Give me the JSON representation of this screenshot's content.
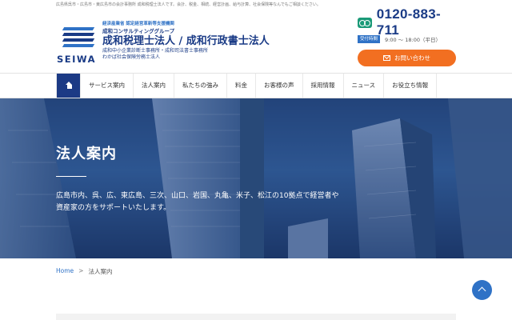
{
  "top_note": "広島県呉市・広島市・東広島市の会計事務所 成和税理士法人です。会計、税金、相続、経営計画、給与計算、社会保険等なんでもご相談ください。",
  "logo": {
    "tagline": "経済産業省 認定経営革新等支援機関",
    "wordmark": "SEIWA",
    "group": "成和コンサルティンググループ",
    "name": "成和税理士法人 / 成和行政書士法人",
    "sub1": "成和中小企業診断士事務所・成和司法書士事務所",
    "sub2": "わかば社会保険労務士法人"
  },
  "contact": {
    "phone": "0120-883-711",
    "hours_badge": "受付時間",
    "hours": "9:00 〜 18:00（平日）",
    "button_label": "お問い合わせ"
  },
  "nav": {
    "items": [
      {
        "label": "サービス案内"
      },
      {
        "label": "法人案内"
      },
      {
        "label": "私たちの強み"
      },
      {
        "label": "料金"
      },
      {
        "label": "お客様の声"
      },
      {
        "label": "採用情報"
      },
      {
        "label": "ニュース"
      },
      {
        "label": "お役立ち情報"
      }
    ]
  },
  "hero": {
    "title": "法人案内",
    "description": "広島市内、呉、広、東広島、三次、山口、岩国、丸亀、米子、松江の10拠点で経営者や資産家の方をサポートいたします。"
  },
  "breadcrumb": {
    "home": "Home",
    "separator": ">",
    "current": "法人案内"
  },
  "colors": {
    "brand_navy": "#1c3a85",
    "accent_blue": "#2f72c6",
    "cta_orange": "#f26f21",
    "phone_green": "#1b9a78"
  },
  "icons": [
    "home-icon",
    "phone-icon",
    "mail-icon",
    "arrow-up-icon"
  ]
}
